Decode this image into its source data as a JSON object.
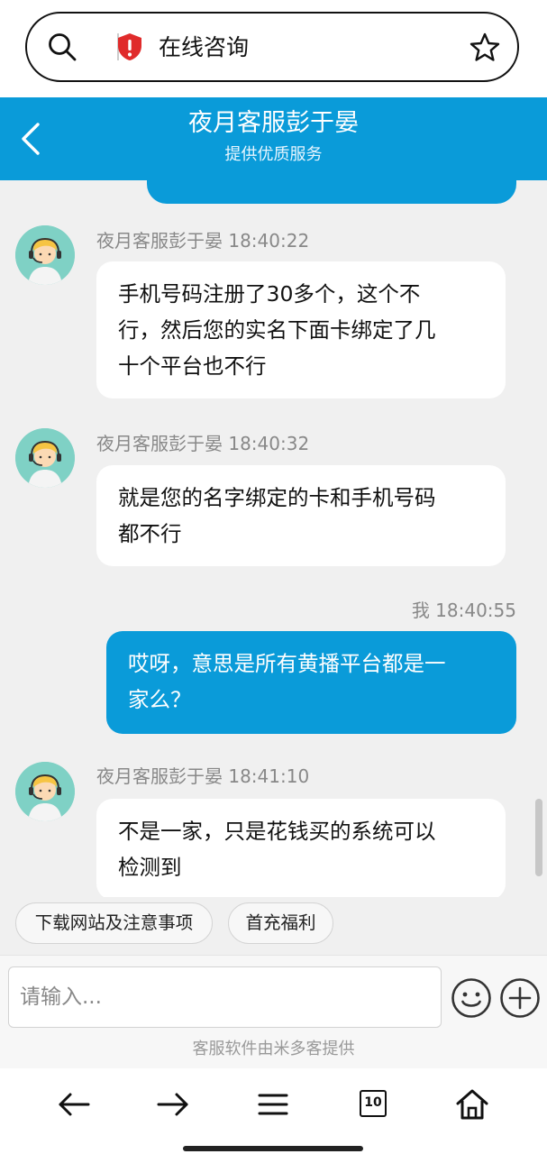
{
  "browser": {
    "url_title": "在线咨询",
    "tab_count": "10"
  },
  "header": {
    "title": "夜月客服彭于晏",
    "subtitle": "提供优质服务"
  },
  "messages": [
    {
      "sender": "夜月客服彭于晏",
      "time": "18:40:22",
      "text": "手机号码注册了30多个，这个不行，然后您的实名下面卡绑定了几十个平台也不行",
      "lines": [
        "手机号码注册了30多个，这个不",
        "行，然后您的实名下面卡绑定了几",
        "十个平台也不行"
      ],
      "from_me": false
    },
    {
      "sender": "夜月客服彭于晏",
      "time": "18:40:32",
      "text": "就是您的名字绑定的卡和手机号码都不行",
      "lines": [
        "就是您的名字绑定的卡和手机号码",
        "都不行"
      ],
      "from_me": false
    },
    {
      "sender": "我",
      "time": "18:40:55",
      "text": "哎呀，意思是所有黄播平台都是一家么？",
      "lines": [
        "哎呀，意思是所有黄播平台都是一",
        "家么？"
      ],
      "from_me": true
    },
    {
      "sender": "夜月客服彭于晏",
      "time": "18:41:10",
      "text": "不是一家，只是花钱买的系统可以检测到",
      "lines": [
        "不是一家，只是花钱买的系统可以",
        "检测到"
      ],
      "from_me": false
    }
  ],
  "quick_replies": [
    "下载网站及注意事项",
    "首充福利"
  ],
  "input": {
    "placeholder": "请输入...",
    "value": ""
  },
  "footer": {
    "powered_by": "客服软件由米多客提供"
  },
  "colors": {
    "accent": "#0a9bd9",
    "my_bubble": "#0a9bd9",
    "their_bubble": "#ffffff",
    "background": "#f0f0f0",
    "shield": "#e02b2b"
  },
  "icons": {
    "url_left": "search-icon",
    "security": "shield-alert-icon",
    "url_right": "star-icon",
    "header_back": "chevron-left-icon",
    "emoji": "smile-icon",
    "attach": "plus-circle-icon",
    "nav": [
      "arrow-left-icon",
      "arrow-right-icon",
      "menu-icon",
      "tabs-icon",
      "home-icon"
    ]
  }
}
